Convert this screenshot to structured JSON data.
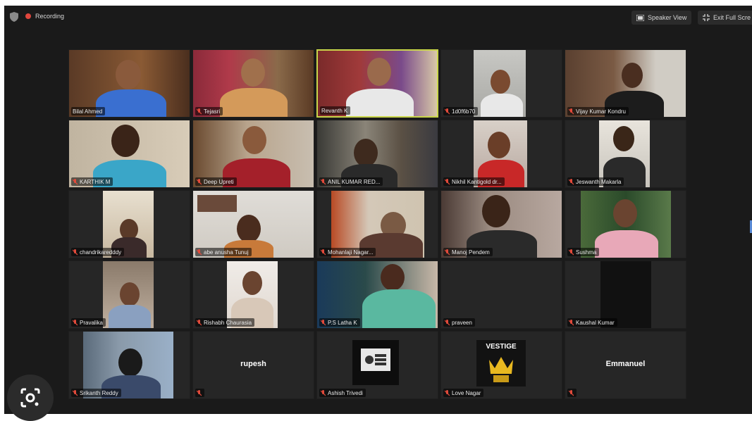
{
  "header": {
    "recording_label": "Recording",
    "speaker_view_label": "Speaker View",
    "exit_full_screen_label": "Exit Full Scre",
    "recording_color": "#e0463d"
  },
  "colors": {
    "window_bg": "#1a1a1a",
    "tile_bg": "#262626",
    "active_speaker_border": "#c9d64a",
    "muted_mic": "#e24a3b"
  },
  "participants": [
    {
      "name": "Bilal Ahmed",
      "video": true,
      "muted": false
    },
    {
      "name": "Tejasri",
      "video": true,
      "muted": true
    },
    {
      "name": "Revanth K",
      "video": true,
      "muted": false,
      "active_speaker": true
    },
    {
      "name": "1d0f6b70",
      "video": true,
      "muted": true
    },
    {
      "name": "Vijay Kumar Kondru",
      "video": true,
      "muted": true
    },
    {
      "name": "KARTHIK M",
      "video": true,
      "muted": true
    },
    {
      "name": "Deep Upreti",
      "video": true,
      "muted": true
    },
    {
      "name": "ANIL KUMAR RED...",
      "video": true,
      "muted": true
    },
    {
      "name": "Nikhil Kantigold dr...",
      "video": true,
      "muted": true
    },
    {
      "name": "Jeswanth Makarla",
      "video": true,
      "muted": true
    },
    {
      "name": "chandrikaredddy",
      "video": true,
      "muted": true
    },
    {
      "name": "abe anusha Tunuj",
      "video": true,
      "muted": true
    },
    {
      "name": "Mohanlaji Nagar...",
      "video": true,
      "muted": true
    },
    {
      "name": "Manoj Pendem",
      "video": true,
      "muted": true
    },
    {
      "name": "Sushma",
      "video": true,
      "muted": true
    },
    {
      "name": "Pravalika",
      "video": true,
      "muted": true
    },
    {
      "name": "Rishabh Chaurasia",
      "video": true,
      "muted": true
    },
    {
      "name": "P.S Latha K",
      "video": true,
      "muted": true
    },
    {
      "name": "praveen",
      "video": false,
      "muted": true
    },
    {
      "name": "Kaushal Kumar",
      "video": true,
      "muted": true
    },
    {
      "name": "Srikanth Reddy",
      "video": true,
      "muted": true
    },
    {
      "name": "",
      "video": false,
      "muted": true,
      "center_name": "rupesh"
    },
    {
      "name": "Ashish Trivedi",
      "video": false,
      "muted": true,
      "avatar_icon": "logo-avatar-icon"
    },
    {
      "name": "Love Nagar",
      "video": false,
      "muted": true,
      "avatar_text": "VESTIGE",
      "avatar_icon": "crown-logo-icon"
    },
    {
      "name": "",
      "video": false,
      "muted": true,
      "center_name": "Emmanuel"
    }
  ]
}
